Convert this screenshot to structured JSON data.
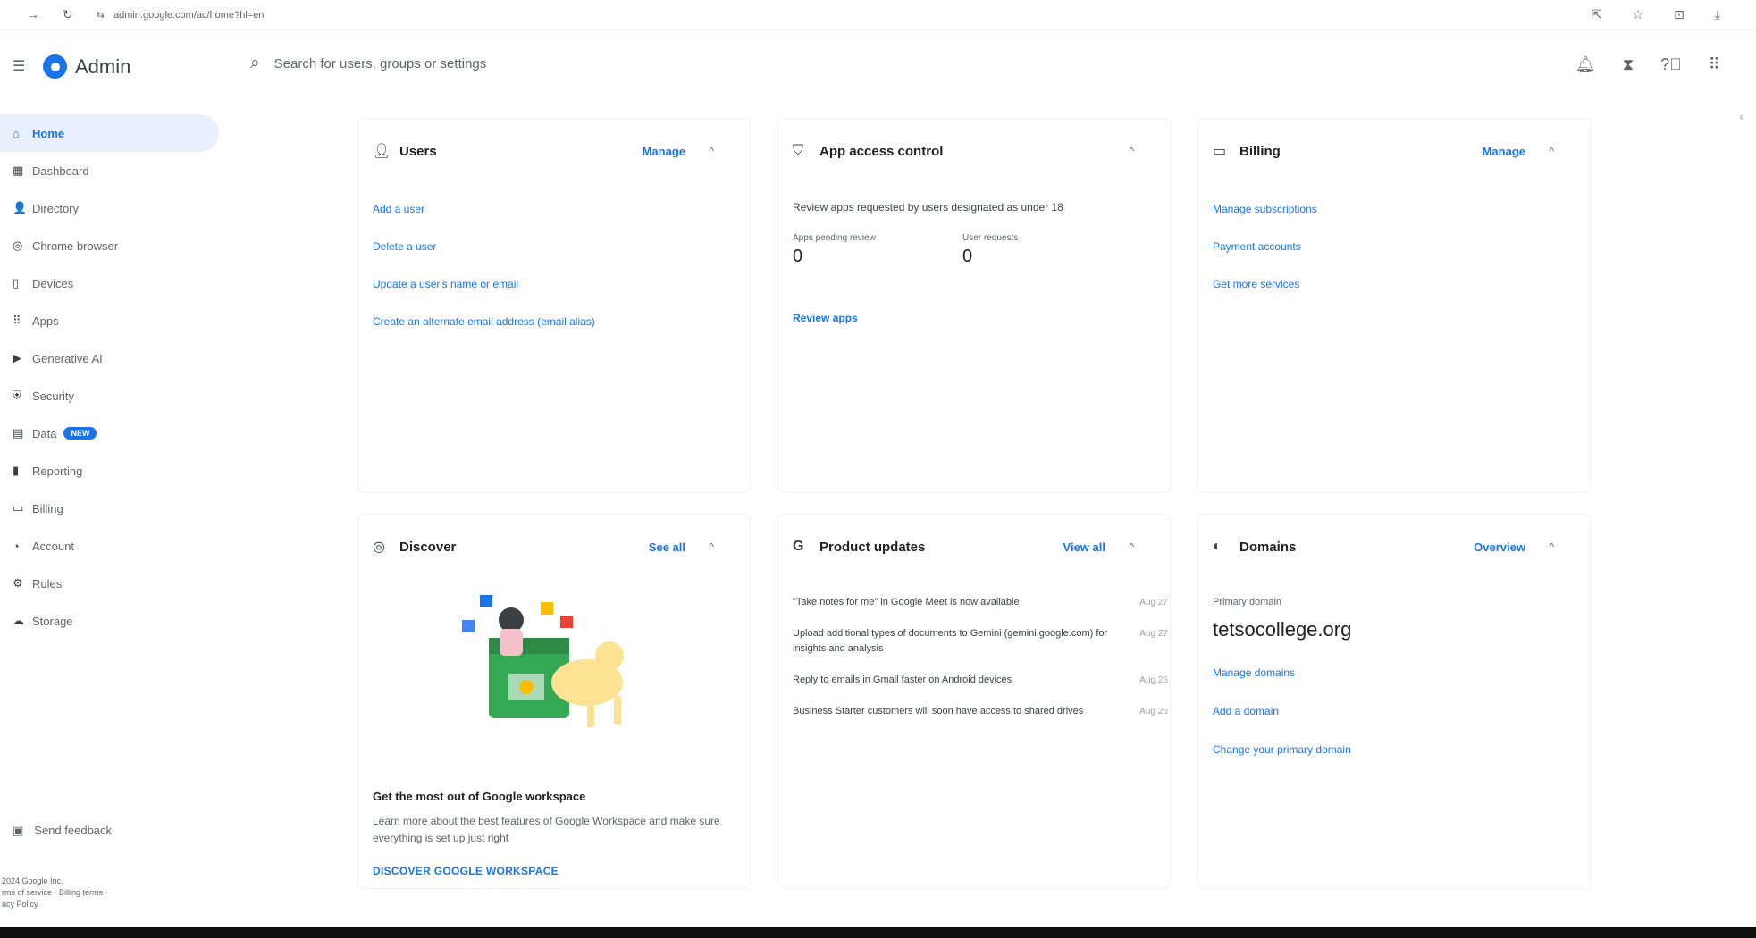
{
  "browser": {
    "url": "admin.google.com/ac/home?hl=en",
    "nav": [
      "→",
      "↻",
      "⇆"
    ],
    "right_icons": [
      "⇱",
      "☆",
      "⊡",
      "⤓"
    ]
  },
  "header": {
    "app_title": "Admin",
    "search_placeholder": "Search for users, groups or settings",
    "icons": [
      "bell-icon",
      "hourglass-icon",
      "help-icon",
      "apps-grid-icon"
    ]
  },
  "sidebar": {
    "items": [
      {
        "label": "Home",
        "icon": "⌂",
        "active": true
      },
      {
        "label": "Dashboard",
        "icon": "▦"
      },
      {
        "label": "Directory",
        "icon": "👤"
      },
      {
        "label": "Chrome browser",
        "icon": "◎"
      },
      {
        "label": "Devices",
        "icon": "▯"
      },
      {
        "label": "Apps",
        "icon": "⠿"
      },
      {
        "label": "Generative AI",
        "icon": "▶"
      },
      {
        "label": "Security",
        "icon": "⛨"
      },
      {
        "label": "Data",
        "icon": "▤",
        "badge": "NEW"
      },
      {
        "label": "Reporting",
        "icon": "▮"
      },
      {
        "label": "Billing",
        "icon": "▭"
      },
      {
        "label": "Account",
        "icon": "◔"
      },
      {
        "label": "Rules",
        "icon": "⚙"
      },
      {
        "label": "Storage",
        "icon": "☁"
      }
    ],
    "feedback_label": "Send feedback",
    "footer_lines": [
      "2024 Google Inc.",
      "rms of service · Billing terms ·",
      "acy Policy"
    ]
  },
  "cards": {
    "users": {
      "title": "Users",
      "action": "Manage",
      "links": [
        "Add a user",
        "Delete a user",
        "Update a user's name or email",
        "Create an alternate email address (email alias)"
      ]
    },
    "app_access": {
      "title": "App access control",
      "description": "Review apps requested by users designated as under 18",
      "stat1_label": "Apps pending review",
      "stat1_value": "0",
      "stat2_label": "User requests",
      "stat2_value": "0",
      "link": "Review apps"
    },
    "billing": {
      "title": "Billing",
      "action": "Manage",
      "links": [
        "Manage subscriptions",
        "Payment accounts",
        "Get more services"
      ]
    },
    "discover": {
      "title": "Discover",
      "action": "See all",
      "heading": "Get the most out of Google workspace",
      "description": "Learn more about the best features of Google Workspace and make sure everything is set up just right",
      "cta": "DISCOVER GOOGLE WORKSPACE"
    },
    "updates": {
      "title": "Product updates",
      "action": "View all",
      "items": [
        {
          "text": "\"Take notes for me\" in Google Meet is now available",
          "date": "Aug 27"
        },
        {
          "text": "Upload additional types of documents to Gemini (gemini.google.com) for insights and analysis",
          "date": "Aug 27"
        },
        {
          "text": "Reply to emails in Gmail faster on Android devices",
          "date": "Aug 26"
        },
        {
          "text": "Business Starter customers will soon have access to shared drives",
          "date": "Aug 26"
        }
      ]
    },
    "domains": {
      "title": "Domains",
      "action": "Overview",
      "primary_label": "Primary domain",
      "primary_value": "tetsocollege.org",
      "links": [
        "Manage domains",
        "Add a domain",
        "Change your primary domain"
      ]
    }
  }
}
